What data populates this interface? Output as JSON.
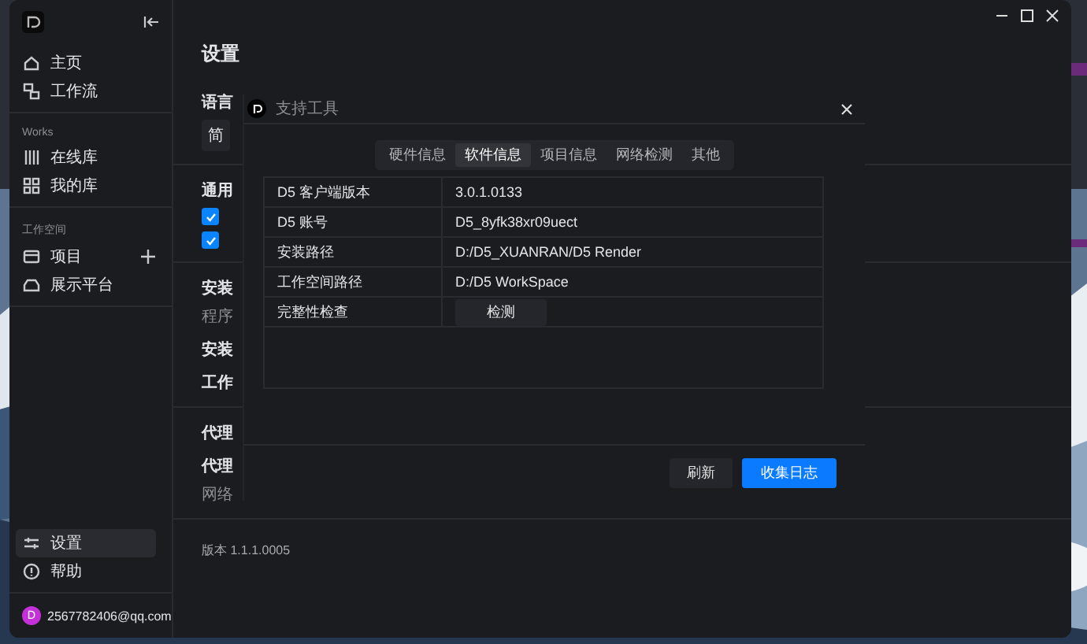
{
  "sidebar": {
    "groups": [
      {
        "items": [
          {
            "label": "主页",
            "selected": false,
            "has_add": false
          },
          {
            "label": "工作流",
            "selected": false,
            "has_add": false
          }
        ]
      },
      {
        "heading": "Works",
        "items": [
          {
            "label": "在线库",
            "selected": false,
            "has_add": false
          },
          {
            "label": "我的库",
            "selected": false,
            "has_add": false
          }
        ]
      },
      {
        "heading": "工作空间",
        "items": [
          {
            "label": "项目",
            "selected": false,
            "has_add": true
          },
          {
            "label": "展示平台",
            "selected": false,
            "has_add": false
          }
        ]
      }
    ],
    "bottom": [
      {
        "label": "设置",
        "selected": true
      },
      {
        "label": "帮助",
        "selected": false
      }
    ],
    "user": {
      "avatar": "D",
      "email": "2567782406@qq.com"
    }
  },
  "settings": {
    "title": "设置",
    "sections": [
      {
        "items": [
          {
            "kind": "heading",
            "text": "语言"
          },
          {
            "kind": "select",
            "text": "简"
          }
        ]
      },
      {
        "items": [
          {
            "kind": "heading",
            "text": "通用"
          },
          {
            "kind": "checkbox",
            "checked": true
          },
          {
            "kind": "checkbox",
            "checked": true
          }
        ]
      },
      {
        "items": [
          {
            "kind": "heading",
            "text": "安装"
          },
          {
            "kind": "note",
            "text": "程序"
          },
          {
            "kind": "heading",
            "text": "安装"
          },
          {
            "kind": "heading",
            "text": "工作"
          }
        ]
      },
      {
        "items": [
          {
            "kind": "heading",
            "text": "代理"
          },
          {
            "kind": "heading",
            "text": "代理"
          },
          {
            "kind": "note",
            "text": "网络"
          }
        ]
      },
      {
        "items": [
          {
            "kind": "version",
            "text": "版本 1.1.1.0005"
          }
        ]
      }
    ]
  },
  "dialog": {
    "title": "支持工具",
    "tabs": [
      {
        "label": "硬件信息",
        "selected": false
      },
      {
        "label": "软件信息",
        "selected": true
      },
      {
        "label": "项目信息",
        "selected": false
      },
      {
        "label": "网络检测",
        "selected": false
      },
      {
        "label": "其他",
        "selected": false
      }
    ],
    "rows": [
      {
        "label": "D5 客户端版本",
        "kind": "text",
        "value": "3.0.1.0133"
      },
      {
        "label": "D5 账号",
        "kind": "text",
        "value": "D5_8yfk38xr09uect"
      },
      {
        "label": "安装路径",
        "kind": "text",
        "value": "D:/D5_XUANRAN/D5 Render"
      },
      {
        "label": "工作空间路径",
        "kind": "text",
        "value": "D:/D5 WorkSpace"
      },
      {
        "label": "完整性检查",
        "kind": "button",
        "value": "检测"
      }
    ],
    "buttons": [
      {
        "label": "刷新",
        "primary": false
      },
      {
        "label": "收集日志",
        "primary": true
      }
    ]
  }
}
